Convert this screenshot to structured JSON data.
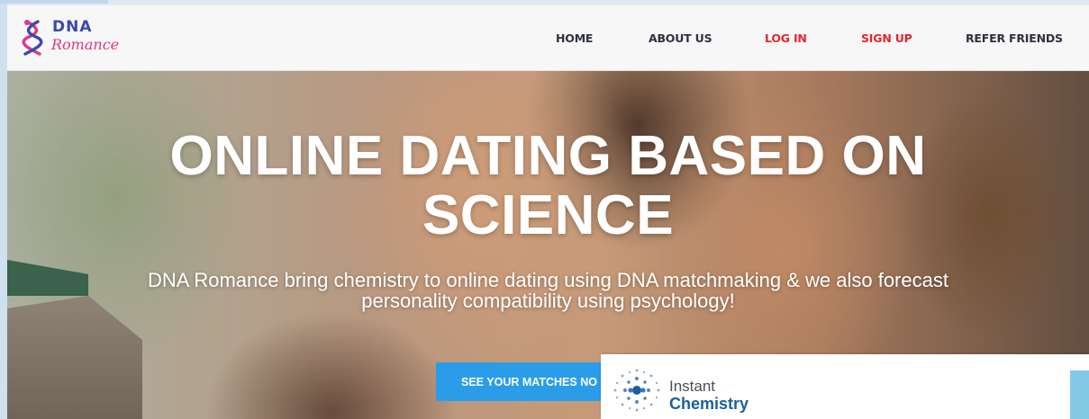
{
  "header": {
    "logo": {
      "line1": "DNA",
      "line2": "Romance",
      "icon": "dna-helix-icon"
    },
    "nav": [
      {
        "label": "HOME",
        "color": "#2e3240"
      },
      {
        "label": "ABOUT US",
        "color": "#2e3240"
      },
      {
        "label": "LOG IN",
        "color": "#e3262e"
      },
      {
        "label": "SIGN UP",
        "color": "#e3262e"
      },
      {
        "label": "REFER FRIENDS",
        "color": "#2e3240"
      }
    ]
  },
  "hero": {
    "title_line1": "ONLINE DATING BASED ON",
    "title_line2": "SCIENCE",
    "subtitle_line1": "DNA Romance bring chemistry to online dating using DNA matchmaking & we also forecast",
    "subtitle_line2": "personality compatibility using psychology!",
    "cta_label": "SEE YOUR MATCHES NO",
    "cta_color": "#2b9de8"
  },
  "overlay_card": {
    "line1": "Instant",
    "line2": "Chemistry",
    "icon": "dots-starburst-icon",
    "brand_color": "#1d5f9b"
  }
}
